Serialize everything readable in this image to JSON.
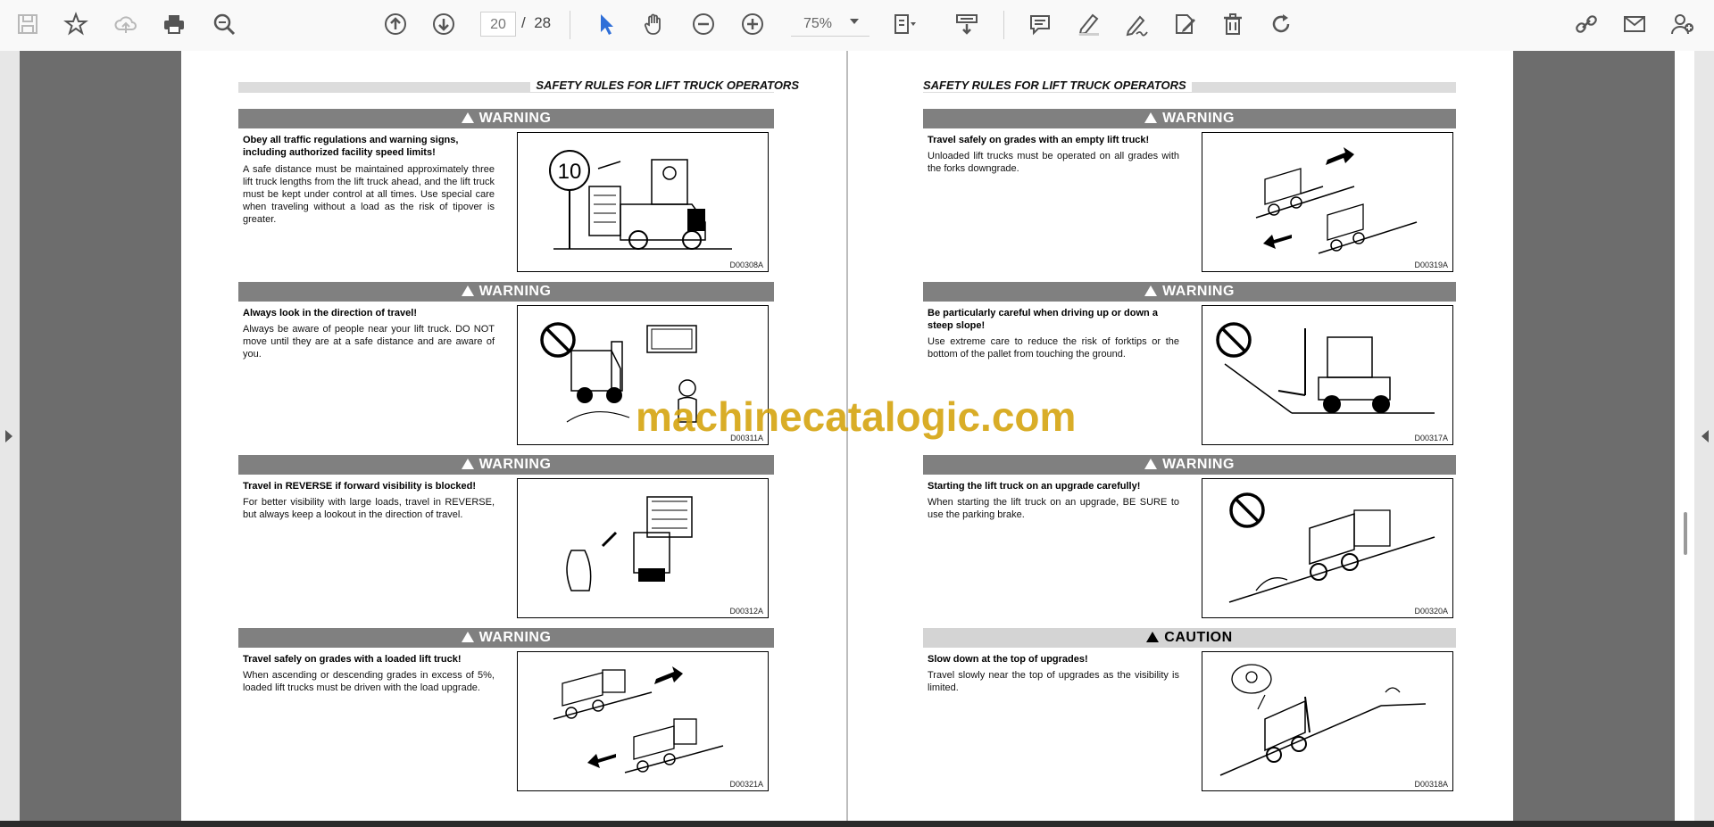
{
  "toolbar": {
    "current_page": "20",
    "page_separator": "/",
    "total_pages": "28",
    "zoom": "75%"
  },
  "left_page": {
    "header": "SAFETY RULES FOR LIFT TRUCK OPERATORS",
    "sections": [
      {
        "banner": "WARNING",
        "title": "Obey all traffic regulations and warning signs, including authorized facility speed limits!",
        "body": "A safe distance must be maintained approximately three lift truck lengths from the lift truck ahead, and the lift truck must be kept under control at all times. Use special care when traveling without a load as the risk of tipover is greater.",
        "figure": "D00308A"
      },
      {
        "banner": "WARNING",
        "title": "Always look in the direction of travel!",
        "body": "Always be aware of people near your lift truck. DO NOT move until they are at a safe distance and are aware of you.",
        "figure": "D00311A"
      },
      {
        "banner": "WARNING",
        "title": "Travel in REVERSE if forward visibility is blocked!",
        "body": "For better visibility with large loads, travel in REVERSE, but always keep a lookout in the direction of travel.",
        "figure": "D00312A"
      },
      {
        "banner": "WARNING",
        "title": "Travel safely on grades with a loaded lift truck!",
        "body": "When ascending or descending grades in excess of 5%, loaded lift trucks must be driven with the load upgrade.",
        "figure": "D00321A"
      }
    ]
  },
  "right_page": {
    "header": "SAFETY RULES FOR LIFT TRUCK OPERATORS",
    "sections": [
      {
        "banner": "WARNING",
        "title": "Travel safely on grades with an empty lift truck!",
        "body": "Unloaded lift trucks must be operated on all grades with the forks downgrade.",
        "figure": "D00319A"
      },
      {
        "banner": "WARNING",
        "title": "Be particularly careful when driving up or down a steep slope!",
        "body": "Use extreme care to reduce the risk of forktips or the bottom of the pallet from touching the ground.",
        "figure": "D00317A"
      },
      {
        "banner": "WARNING",
        "title": "Starting the lift truck on an upgrade carefully!",
        "body": "When starting the lift truck on an upgrade, BE SURE to use the parking brake.",
        "figure": "D00320A"
      },
      {
        "banner": "CAUTION",
        "title": "Slow down at the top of upgrades!",
        "body": "Travel slowly near the top of upgrades as the visibility is limited.",
        "figure": "D00318A"
      }
    ]
  },
  "figure_texts": {
    "speed_sign": "10"
  },
  "watermark": "machinecatalogic.com",
  "colors": {
    "warning_banner": "#808080",
    "caution_banner": "#d4d4d4",
    "select_tool": "#2f6fd8",
    "watermark": "#d4a20a"
  }
}
